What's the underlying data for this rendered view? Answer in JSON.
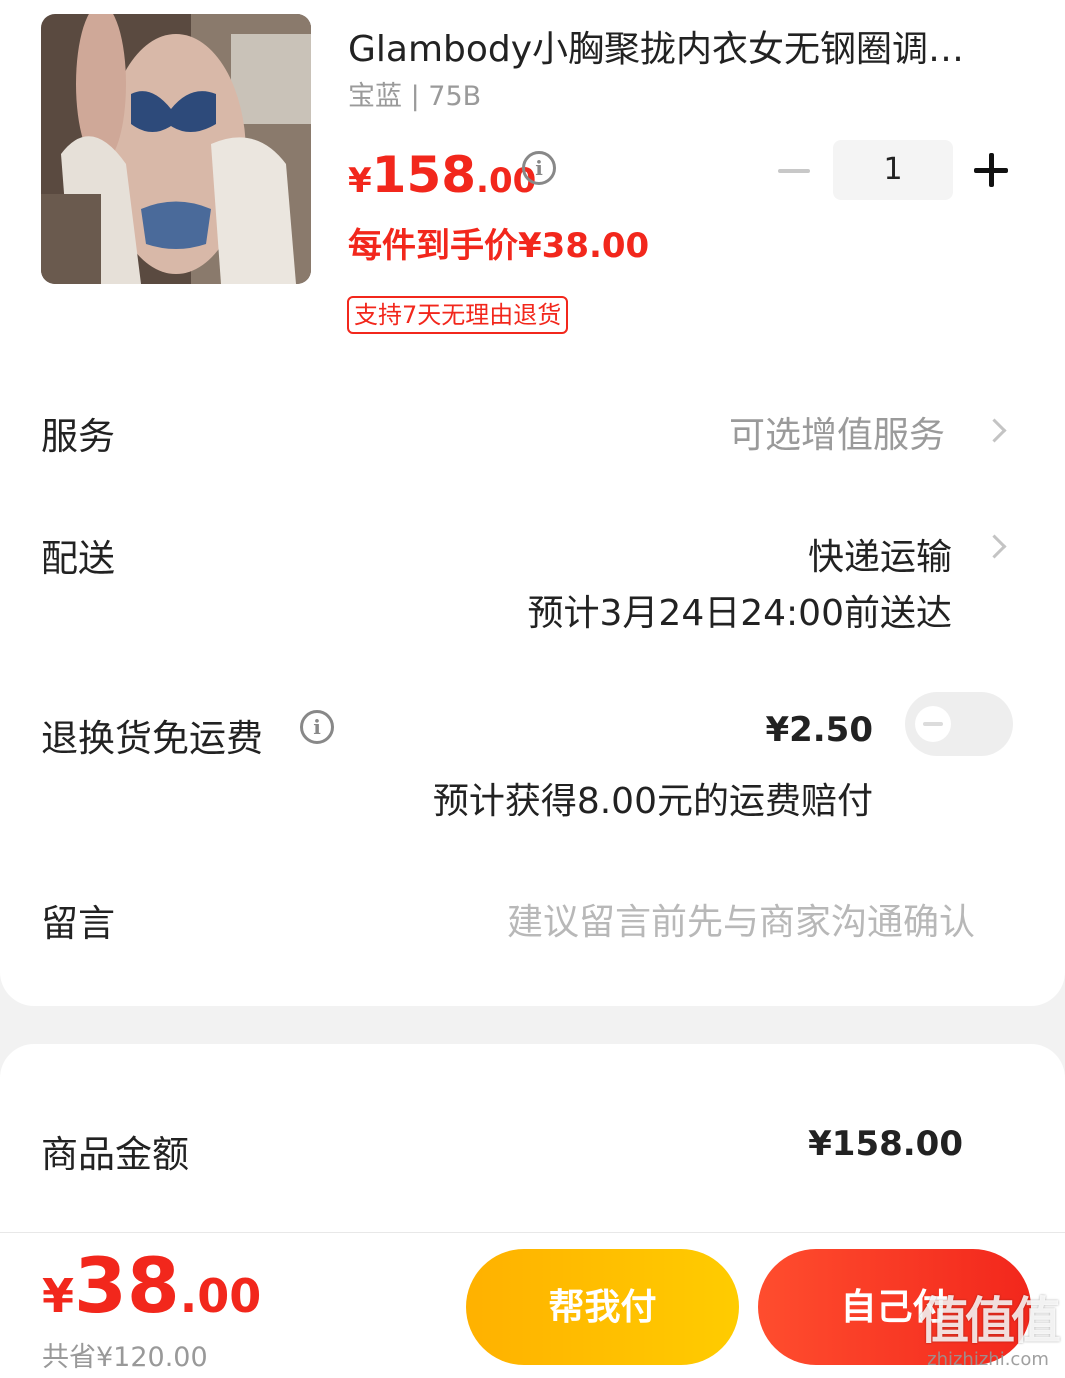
{
  "product": {
    "title": "Glambody小胸聚拢内衣女无钢圈调…",
    "sku": "宝蓝 | 75B",
    "price_currency": "¥",
    "price_integer": "158",
    "price_decimal": ".00",
    "deal_price": "每件到手价¥38.00",
    "return_tag": "支持7天无理由退货",
    "quantity": "1"
  },
  "rows": {
    "service_label": "服务",
    "service_value": "可选增值服务",
    "delivery_label": "配送",
    "delivery_value": "快递运输",
    "delivery_eta": "预计3月24日24:00前送达",
    "freight_label": "退换货免运费",
    "freight_value": "¥2.50",
    "freight_note": "预计获得8.00元的运费赔付",
    "freight_enabled": false,
    "message_label": "留言",
    "message_placeholder": "建议留言前先与商家沟通确认"
  },
  "summary": {
    "goods_amount_label": "商品金额",
    "goods_amount_value": "¥158.00"
  },
  "bottom": {
    "total_currency": "¥",
    "total_integer": "38",
    "total_decimal": ".00",
    "saved": "共省¥120.00",
    "help_pay_label": "帮我付",
    "self_pay_label": "自己付"
  },
  "watermark": {
    "glyphs": "值值值",
    "text": "zhizhizhi.com"
  },
  "colors": {
    "accent_red": "#f2271c",
    "help_button": "#ffbe00",
    "muted_text": "#9a9a9a"
  }
}
